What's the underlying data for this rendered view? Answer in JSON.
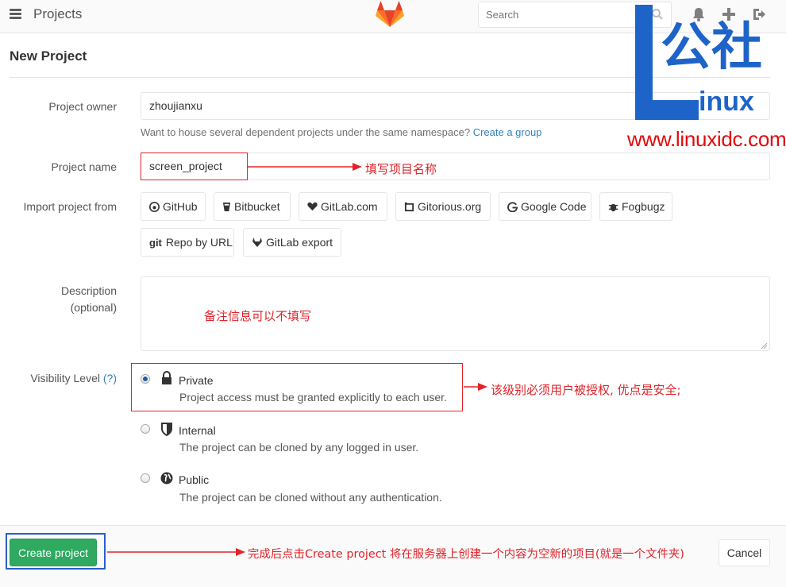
{
  "header": {
    "title": "Projects",
    "search_placeholder": "Search",
    "icons": [
      "menu-icon",
      "gitlab-logo",
      "search-icon",
      "bell-icon",
      "plus-icon",
      "sign-out-icon"
    ]
  },
  "page": {
    "title": "New Project"
  },
  "form": {
    "owner": {
      "label": "Project owner",
      "value": "zhoujianxu"
    },
    "namespace_help": {
      "text": "Want to house several dependent projects under the same namespace?",
      "link": "Create a group"
    },
    "name": {
      "label": "Project name",
      "value": "screen_project"
    },
    "import": {
      "label": "Import project from",
      "sources": [
        "GitHub",
        "Bitbucket",
        "GitLab.com",
        "Gitorious.org",
        "Google Code",
        "Fogbugz",
        "Repo by URL",
        "GitLab export"
      ]
    },
    "description": {
      "label": "Description",
      "sublabel": "(optional)",
      "value": ""
    },
    "visibility": {
      "label": "Visibility Level",
      "help": "(?)",
      "selected": "Private",
      "options": [
        {
          "title": "Private",
          "desc": "Project access must be granted explicitly to each user."
        },
        {
          "title": "Internal",
          "desc": "The project can be cloned by any logged in user."
        },
        {
          "title": "Public",
          "desc": "The project can be cloned without any authentication."
        }
      ]
    }
  },
  "buttons": {
    "create": "Create project",
    "cancel": "Cancel"
  },
  "annotations": {
    "name": "填写项目名称",
    "description": "备注信息可以不填写",
    "visibility": "该级别必须用户被授权, 优点是安全;",
    "create": "完成后点击Create project 将在服务器上创建一个内容为空新的项目(就是一个文件夹)"
  },
  "watermark": {
    "brand": "公社",
    "brand_sub": "inux",
    "url": "www.linuxidc.com"
  },
  "colors": {
    "accent": "#2faa60",
    "annotation": "#e0242a",
    "link": "#3084bb",
    "frame": "#2b5fc8",
    "watermark": "#1e64c8"
  }
}
